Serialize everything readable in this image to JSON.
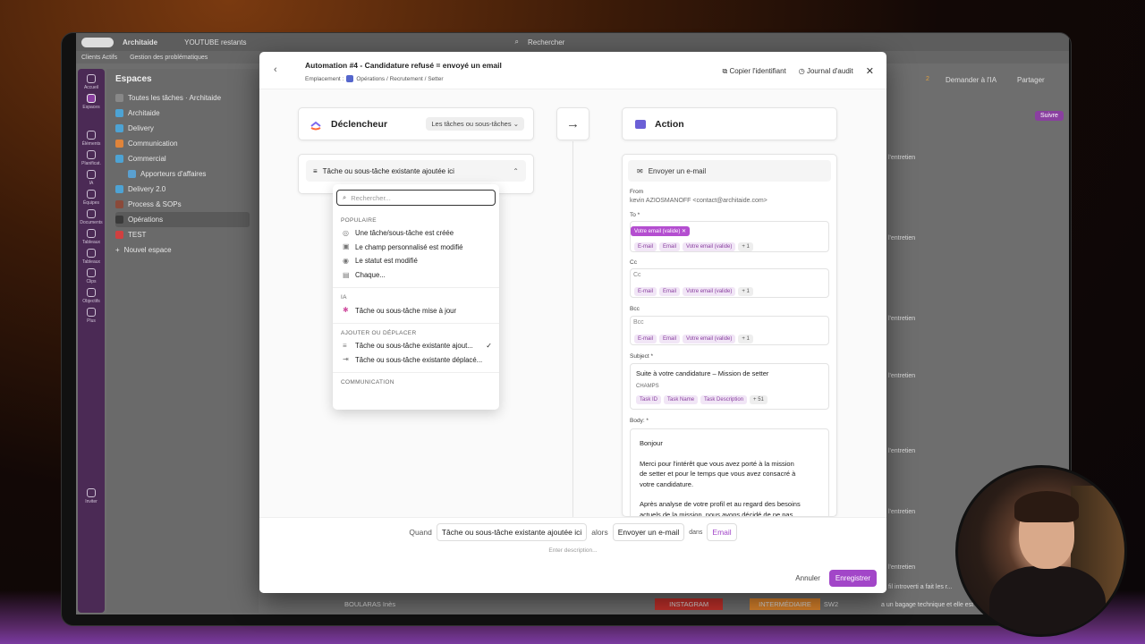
{
  "bg_app": {
    "workspace_name": "Architaide",
    "tab_youtube": "YOUTUBE restants",
    "search": "Rechercher",
    "sub_items": [
      "Clients Actifs",
      "Gestion des problématiques"
    ],
    "spaces_title": "Espaces",
    "spaces": [
      {
        "label": "Toutes les tâches · Architaide",
        "color": "#888"
      },
      {
        "label": "Architaide",
        "color": "#4da3d4"
      },
      {
        "label": "Delivery",
        "color": "#4da3d4"
      },
      {
        "label": "Communication",
        "color": "#e0843a"
      },
      {
        "label": "Commercial",
        "color": "#4da3d4"
      },
      {
        "label": "Apporteurs d'affaires",
        "color": "#5aa0d0"
      },
      {
        "label": "Delivery 2.0",
        "color": "#4da3d4"
      },
      {
        "label": "Process & SOPs",
        "color": "#8a4a3a"
      },
      {
        "label": "Opérations",
        "color": "#3a3a3a"
      },
      {
        "label": "TEST",
        "color": "#d04040"
      },
      {
        "label": "Nouvel espace",
        "color": "#888"
      }
    ],
    "rail": [
      "Accueil",
      "Espaces",
      "Éléments",
      "Planificat.",
      "IA",
      "Équipes",
      "Documents",
      "Tableaux",
      "Tableaux",
      "Clips",
      "Objectifs",
      "Plus",
      "Inviter"
    ],
    "right_header": [
      "Demander à l'IA",
      "Partager"
    ],
    "right_btn": "Suivre",
    "right_rows": [
      "l'entretien",
      "l'entretien",
      "l'entretien",
      "l'entretien",
      "l'entretien",
      "l'entretien",
      "l'entretien",
      "l'entretien"
    ],
    "right_bottom": [
      "fil introverti a fait les r...",
      "a un bagage technique et elle est i..."
    ],
    "bottom_row": {
      "name": "BOULARAS Inès",
      "tag1": "INSTAGRAM",
      "tag2": "INTERMÉDIAIRE",
      "code": "SW2"
    },
    "count": "2"
  },
  "modal": {
    "title": "Automation #4 - Candidature refusé = envoyé un email",
    "location_label": "Emplacement :",
    "location_path": "Opérations / Recrutement / Setter",
    "copy_id": "Copier l'identifiant",
    "audit_log": "Journal d'audit",
    "trigger_title": "Déclencheur",
    "trigger_scope": "Les tâches ou sous-tâches",
    "action_title": "Action",
    "trigger_selected": "Tâche ou sous-tâche existante ajoutée ici",
    "dropdown": {
      "placeholder": "Rechercher...",
      "sections": [
        {
          "title": "POPULAIRE",
          "items": [
            "Une tâche/sous-tâche est créée",
            "Le champ personnalisé est modifié",
            "Le statut est modifié",
            "Chaque..."
          ]
        },
        {
          "title": "IA",
          "items": [
            "Tâche ou sous-tâche mise à jour"
          ]
        },
        {
          "title": "AJOUTER OU DÉPLACER",
          "items": [
            "Tâche ou sous-tâche existante ajout...",
            "Tâche ou sous-tâche existante déplacé..."
          ]
        },
        {
          "title": "COMMUNICATION",
          "items": []
        }
      ]
    },
    "action": {
      "header": "Envoyer un e-mail",
      "from_label": "From",
      "from_value": "kevin AZIOSMANOFF <contact@architaide.com>",
      "to_label": "To *",
      "to_selected": "Votre email (valide)",
      "chips": [
        "E-mail",
        "Email",
        "Votre email (valide)",
        "+ 1"
      ],
      "cc_label": "Cc",
      "cc_placeholder": "Cc",
      "bcc_label": "Bcc",
      "bcc_placeholder": "Bcc",
      "subject_label": "Subject *",
      "subject_value": "Suite à votre candidature – Mission de setter",
      "champs_label": "CHAMPS",
      "subject_chips": [
        "Task ID",
        "Task Name",
        "Task Description",
        "+ 51"
      ],
      "body_label": "Body: *",
      "body_lines": [
        "Bonjour",
        "",
        "Merci pour l'intérêt que vous avez porté à la mission",
        "de setter et pour le temps que vous avez consacré à",
        "votre candidature.",
        "",
        "Après analyse de votre profil et au regard des besoins",
        "actuels de la mission, nous avons décidé de ne pas"
      ]
    },
    "footer": {
      "when": "Quand",
      "trigger": "Tâche ou sous-tâche existante ajoutée ici",
      "then": "alors",
      "action": "Envoyer un e-mail",
      "in": "dans",
      "target": "Email",
      "desc_placeholder": "Enter description...",
      "cancel": "Annuler",
      "save": "Enregistrer"
    }
  }
}
